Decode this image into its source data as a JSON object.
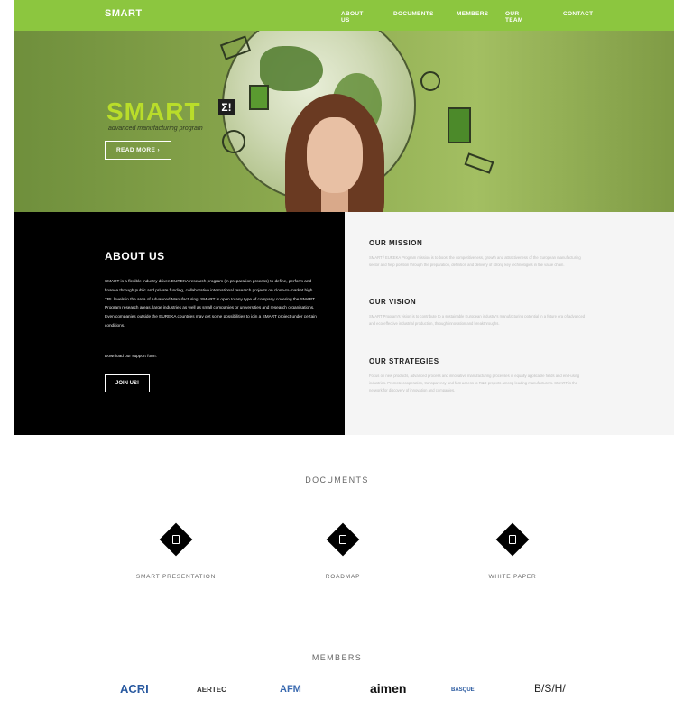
{
  "nav": {
    "brand": "SMART",
    "items": [
      "ABOUT US",
      "DOCUMENTS",
      "MEMBERS",
      "OUR TEAM",
      "CONTACT"
    ]
  },
  "hero": {
    "logo": "SMART",
    "logo_mark": "Σ!",
    "logo_subtitle": "advanced manufacturing program",
    "read_more": "READ MORE ›"
  },
  "about": {
    "title": "ABOUT US",
    "text": "SMART is a flexible industry driven EUREKA research program (in preparation process) to define, perform and finance through public and private funding, collaborative international research projects on close-to-market high TRL levels in the area of Advanced Manufacturing. SMART is open to any type of company covering the SMART Program research areas, large industries as well as small companies or universities and research organisations. Even companies outside the EUREKA countries may get some possibilities to join a SMART project under certain conditions.",
    "download": "Download our support form.",
    "join": "JOIN US!"
  },
  "mission": {
    "title": "OUR MISSION",
    "text": "SMART / EUREKA Program mission is to boost the competitiveness, growth and attractiveness of the European manufacturing sector and help position through the preparation, definition and delivery of strong key technologies in the value chain."
  },
  "vision": {
    "title": "OUR VISION",
    "text": "SMART Program's vision is to contribute to a sustainable European industry's manufacturing potential in a future era of advanced and eco-effective industrial production, through innovation and breakthroughs."
  },
  "strategies": {
    "title": "OUR STRATEGIES",
    "text": "Focus on new products, advanced process and innovative manufacturing processes in equally applicable fields and end-using industries. Promote cooperation, transparency and fast access to R&D projects among leading manufacturers. SMART is the network for discovery of innovation and companies."
  },
  "documents": {
    "title": "DOCUMENTS",
    "items": [
      "SMART PRESENTATION",
      "ROADMAP",
      "WHITE PAPER"
    ]
  },
  "members": {
    "title": "MEMBERS",
    "logos": [
      "ACRI",
      "AERTEC",
      "AFM",
      "aimen",
      "BASQUE",
      "B/S/H/"
    ]
  },
  "colors": {
    "accent": "#8cc63f",
    "dark": "#000000",
    "light_panel": "#f5f5f5"
  }
}
